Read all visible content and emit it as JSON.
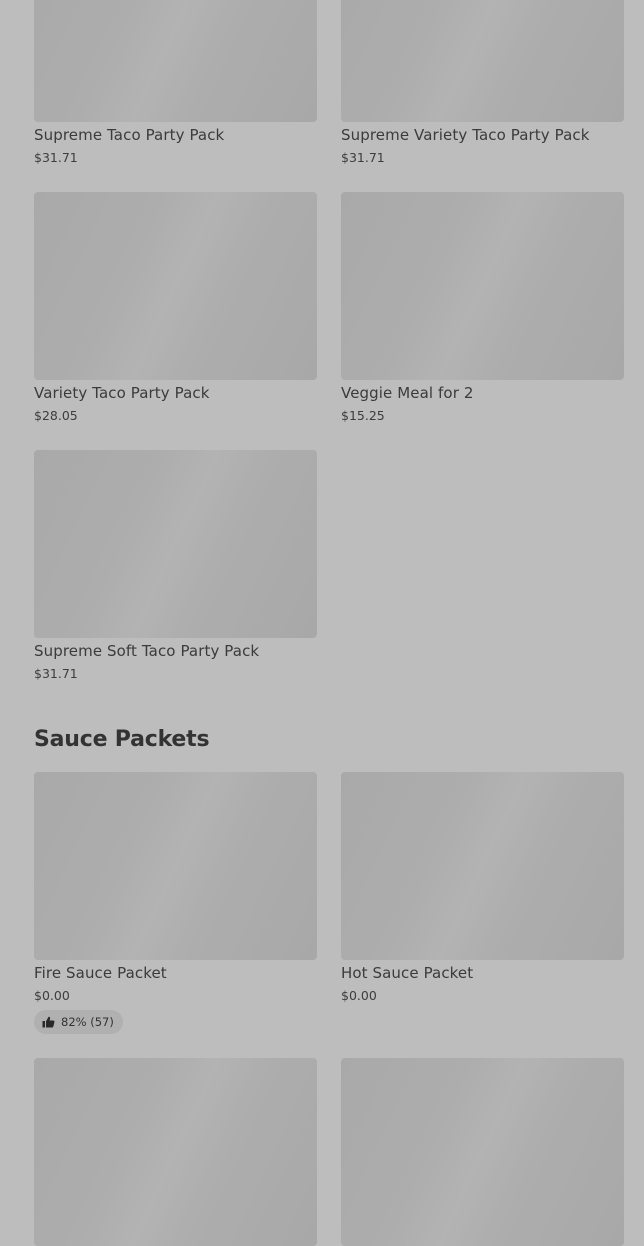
{
  "party_packs": [
    {
      "name": "Supreme Taco Party Pack",
      "price": "$31.71"
    },
    {
      "name": "Supreme Variety Taco Party Pack",
      "price": "$31.71"
    },
    {
      "name": "Variety Taco Party Pack",
      "price": "$28.05"
    },
    {
      "name": "Veggie Meal for 2",
      "price": "$15.25"
    },
    {
      "name": "Supreme Soft Taco Party Pack",
      "price": "$31.71"
    }
  ],
  "sauce_section": {
    "title": "Sauce Packets",
    "items": [
      {
        "name": "Fire Sauce Packet",
        "price": "$0.00",
        "rating": "82% (57)",
        "rating_icon": "thumbs-up-icon"
      },
      {
        "name": "Hot Sauce Packet",
        "price": "$0.00"
      }
    ]
  },
  "colors": {
    "background": "#bdbdbd",
    "placeholder": "#acacac",
    "text": "#3a3a3a"
  }
}
